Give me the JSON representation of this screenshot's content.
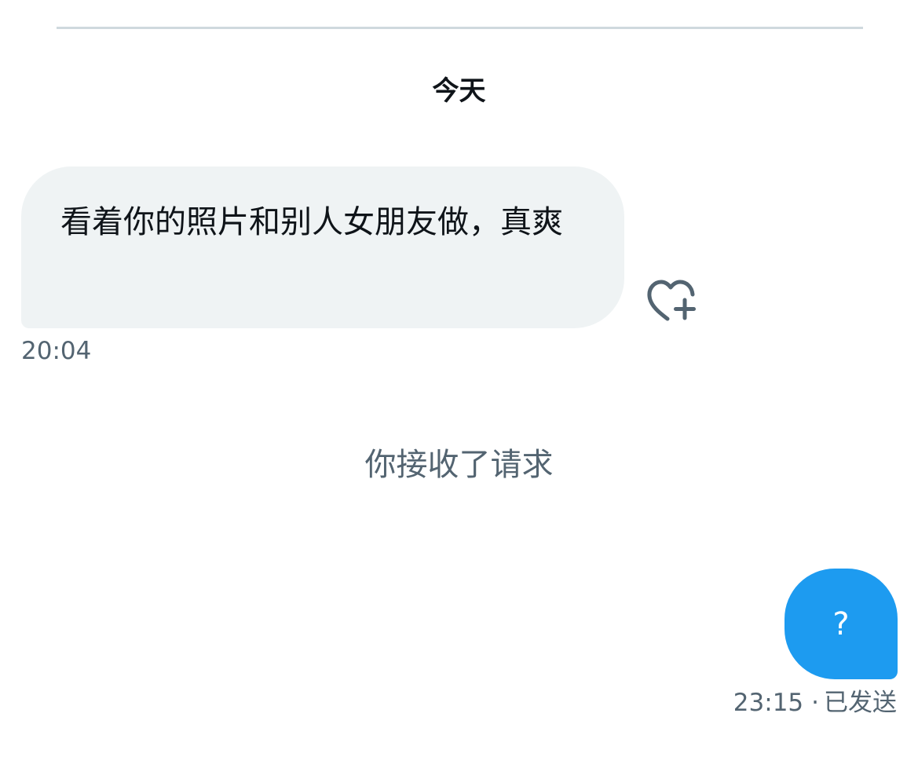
{
  "conversation": {
    "date_header": "今天",
    "messages": [
      {
        "direction": "incoming",
        "text": "看着你的照片和别人女朋友做，真爽",
        "time": "20:04",
        "reaction_icon": "heart-plus-icon"
      },
      {
        "direction": "outgoing",
        "text": "?",
        "time": "23:15",
        "separator": "·",
        "status": "已发送"
      }
    ],
    "system_notice": "你接收了请求"
  },
  "colors": {
    "incoming_bubble": "#eff3f4",
    "outgoing_bubble": "#1d9bf0",
    "secondary_text": "#536471",
    "primary_text": "#0f1419",
    "divider": "#cfd9de"
  }
}
